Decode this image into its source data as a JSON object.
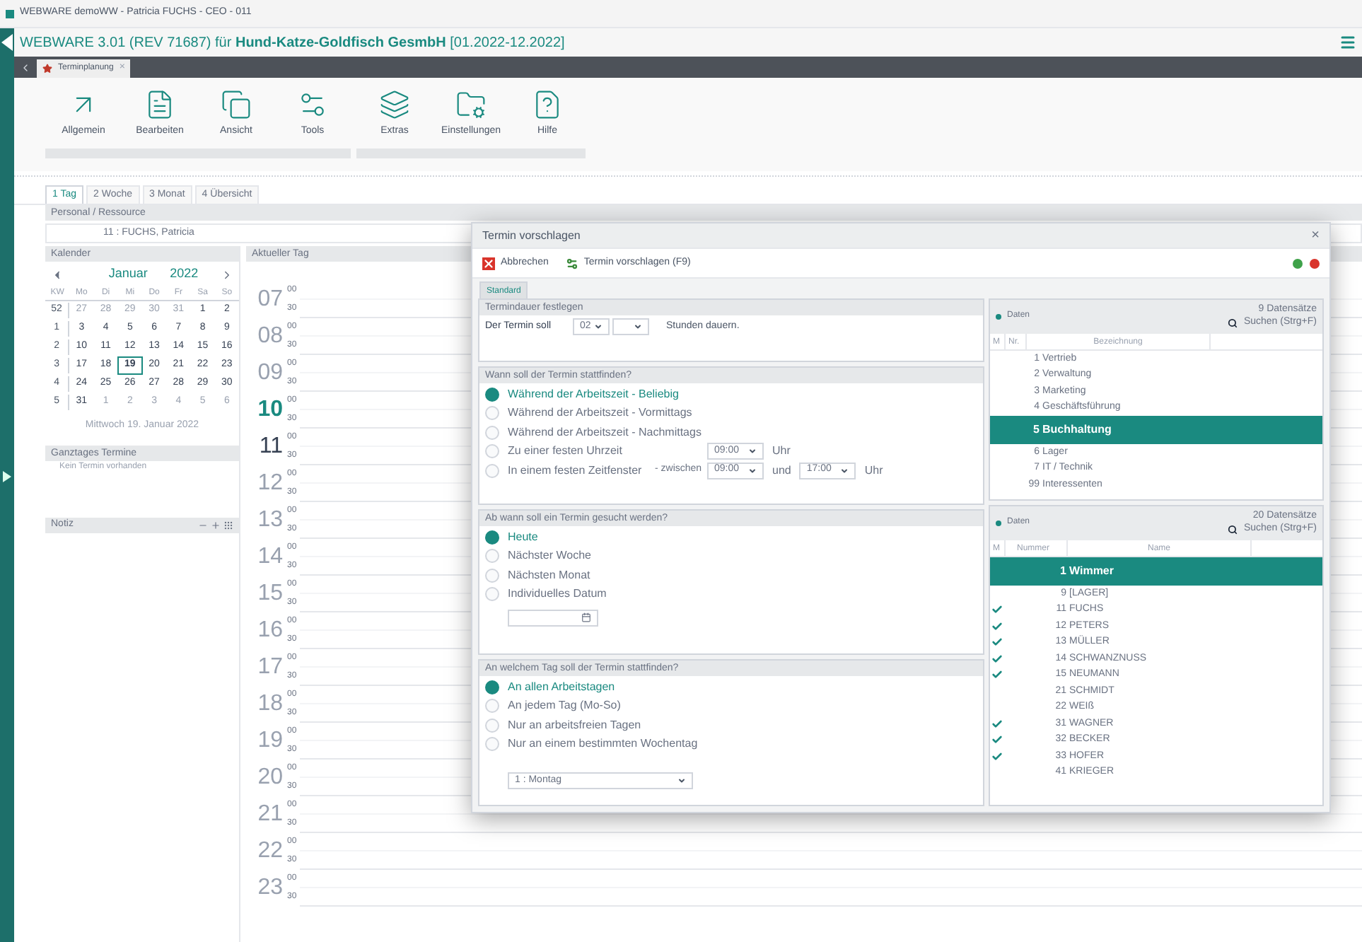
{
  "window": {
    "title": "WEBWARE demoWW - Patricia FUCHS - CEO - 011"
  },
  "app_title": "WEBWARE 3.01 (REV 71687) für **Hund-Katze-Goldfisch GesmbH** [01.2022-12.2022]",
  "doc_tab": {
    "label": "Terminplanung",
    "close": "×"
  },
  "ribbon": [
    {
      "items": [
        "Allgemein",
        "Bearbeiten",
        "Ansicht",
        "Tools"
      ]
    },
    {
      "items": [
        "Extras",
        "Einstellungen",
        "Hilfe"
      ]
    }
  ],
  "view_tabs": [
    {
      "label": "1 Tag",
      "selected": true
    },
    {
      "label": "2 Woche",
      "selected": false
    },
    {
      "label": "3 Monat",
      "selected": false
    },
    {
      "label": "4 Übersicht",
      "selected": false
    }
  ],
  "resource": {
    "header": "Personal / Ressource",
    "value": "11 : FUCHS, Patricia"
  },
  "calendar": {
    "header": "Kalender",
    "month": "Januar",
    "year": "2022",
    "columns": [
      "KW",
      "Mo",
      "Di",
      "Mi",
      "Do",
      "Fr",
      "Sa",
      "So"
    ],
    "weeks": [
      {
        "week": "52",
        "days": [
          {
            "label": "27",
            "muted": true,
            "selected": false
          },
          {
            "label": "28",
            "muted": true,
            "selected": false
          },
          {
            "label": "29",
            "muted": true,
            "selected": false
          },
          {
            "label": "30",
            "muted": true,
            "selected": false
          },
          {
            "label": "31",
            "muted": true,
            "selected": false
          },
          {
            "label": "1",
            "muted": false,
            "selected": false
          },
          {
            "label": "2",
            "muted": false,
            "selected": false
          }
        ]
      },
      {
        "week": "1",
        "days": [
          {
            "label": "3",
            "muted": false,
            "selected": false
          },
          {
            "label": "4",
            "muted": false,
            "selected": false
          },
          {
            "label": "5",
            "muted": false,
            "selected": false
          },
          {
            "label": "6",
            "muted": false,
            "selected": false
          },
          {
            "label": "7",
            "muted": false,
            "selected": false
          },
          {
            "label": "8",
            "muted": false,
            "selected": false
          },
          {
            "label": "9",
            "muted": false,
            "selected": false
          }
        ]
      },
      {
        "week": "2",
        "days": [
          {
            "label": "10",
            "muted": false,
            "selected": false
          },
          {
            "label": "11",
            "muted": false,
            "selected": false
          },
          {
            "label": "12",
            "muted": false,
            "selected": false
          },
          {
            "label": "13",
            "muted": false,
            "selected": false
          },
          {
            "label": "14",
            "muted": false,
            "selected": false
          },
          {
            "label": "15",
            "muted": false,
            "selected": false
          },
          {
            "label": "16",
            "muted": false,
            "selected": false
          }
        ]
      },
      {
        "week": "3",
        "days": [
          {
            "label": "17",
            "muted": false,
            "selected": false
          },
          {
            "label": "18",
            "muted": false,
            "selected": false
          },
          {
            "label": "19",
            "muted": false,
            "selected": true
          },
          {
            "label": "20",
            "muted": false,
            "selected": false
          },
          {
            "label": "21",
            "muted": false,
            "selected": false
          },
          {
            "label": "22",
            "muted": false,
            "selected": false
          },
          {
            "label": "23",
            "muted": false,
            "selected": false
          }
        ]
      },
      {
        "week": "4",
        "days": [
          {
            "label": "24",
            "muted": false,
            "selected": false
          },
          {
            "label": "25",
            "muted": false,
            "selected": false
          },
          {
            "label": "26",
            "muted": false,
            "selected": false
          },
          {
            "label": "27",
            "muted": false,
            "selected": false
          },
          {
            "label": "28",
            "muted": false,
            "selected": false
          },
          {
            "label": "29",
            "muted": false,
            "selected": false
          },
          {
            "label": "30",
            "muted": false,
            "selected": false
          }
        ]
      },
      {
        "week": "5",
        "days": [
          {
            "label": "31",
            "muted": false,
            "selected": false
          },
          {
            "label": "1",
            "muted": true,
            "selected": false
          },
          {
            "label": "2",
            "muted": true,
            "selected": false
          },
          {
            "label": "3",
            "muted": true,
            "selected": false
          },
          {
            "label": "4",
            "muted": true,
            "selected": false
          },
          {
            "label": "5",
            "muted": true,
            "selected": false
          },
          {
            "label": "6",
            "muted": true,
            "selected": false
          }
        ]
      }
    ],
    "date_text": "Mittwoch 19. Januar 2022"
  },
  "all_day": {
    "header": "Ganztages Termine",
    "text": "Kein Termin vorhanden"
  },
  "notes": {
    "header": "Notiz"
  },
  "day_view": {
    "header": "Aktueller Tag",
    "hours": [
      {
        "label": "07",
        "kind": "normal",
        "minutes": [
          "00",
          "30"
        ]
      },
      {
        "label": "08",
        "kind": "normal",
        "minutes": [
          "00",
          "30"
        ]
      },
      {
        "label": "09",
        "kind": "normal",
        "minutes": [
          "00",
          "30"
        ]
      },
      {
        "label": "10",
        "kind": "current",
        "minutes": [
          "00",
          "30"
        ]
      },
      {
        "label": "11",
        "kind": "next",
        "minutes": [
          "00",
          "30"
        ]
      },
      {
        "label": "12",
        "kind": "normal",
        "minutes": [
          "00",
          "30"
        ]
      },
      {
        "label": "13",
        "kind": "normal",
        "minutes": [
          "00",
          "30"
        ]
      },
      {
        "label": "14",
        "kind": "normal",
        "minutes": [
          "00",
          "30"
        ]
      },
      {
        "label": "15",
        "kind": "normal",
        "minutes": [
          "00",
          "30"
        ]
      },
      {
        "label": "16",
        "kind": "normal",
        "minutes": [
          "00",
          "30"
        ]
      },
      {
        "label": "17",
        "kind": "normal",
        "minutes": [
          "00",
          "30"
        ]
      },
      {
        "label": "18",
        "kind": "normal",
        "minutes": [
          "00",
          "30"
        ]
      },
      {
        "label": "19",
        "kind": "normal",
        "minutes": [
          "00",
          "30"
        ]
      },
      {
        "label": "20",
        "kind": "normal",
        "minutes": [
          "00",
          "30"
        ]
      },
      {
        "label": "21",
        "kind": "normal",
        "minutes": [
          "00",
          "30"
        ]
      },
      {
        "label": "22",
        "kind": "normal",
        "minutes": [
          "00",
          "30"
        ]
      },
      {
        "label": "23",
        "kind": "normal",
        "minutes": [
          "00",
          "30"
        ]
      }
    ]
  },
  "dialog": {
    "title": "Termin vorschlagen",
    "close": "×",
    "actions": [
      "Abbrechen",
      "Termin vorschlagen (F9)"
    ],
    "tab": "Standard",
    "duration": {
      "header": "Termindauer festlegen",
      "prefix": "Der Termin soll",
      "hours": "02",
      "suffix": "Stunden dauern."
    },
    "when": {
      "header": "Wann soll der Termin stattfinden?",
      "options": [
        {
          "kind": "plain",
          "label": "Während der Arbeitszeit - Beliebig",
          "selected": true
        },
        {
          "kind": "plain",
          "label": "Während der Arbeitszeit - Vormittags",
          "selected": false
        },
        {
          "kind": "plain",
          "label": "Während der Arbeitszeit - Nachmittags",
          "selected": false
        },
        {
          "kind": "time",
          "label": "Zu einer festen Uhrzeit",
          "selected": false,
          "time": "09:00",
          "unit": "Uhr"
        },
        {
          "kind": "range",
          "label": "In einem festen Zeitfenster",
          "selected": false,
          "between": "- zwischen",
          "from": "09:00",
          "and": "und",
          "to": "17:00",
          "unit": "Uhr"
        }
      ]
    },
    "from": {
      "header": "Ab wann soll ein Termin gesucht werden?",
      "options": [
        {
          "kind": "plain",
          "label": "Heute",
          "selected": true
        },
        {
          "kind": "plain",
          "label": "Nächster Woche",
          "selected": false
        },
        {
          "kind": "plain",
          "label": "Nächsten Monat",
          "selected": false
        },
        {
          "kind": "date",
          "label": "Individuelles Datum",
          "selected": false
        }
      ]
    },
    "day": {
      "header": "An welchem Tag soll der Termin stattfinden?",
      "options": [
        {
          "kind": "plain",
          "label": "An allen Arbeitstagen",
          "selected": true
        },
        {
          "kind": "plain",
          "label": "An jedem Tag (Mo-So)",
          "selected": false
        },
        {
          "kind": "plain",
          "label": "Nur an arbeitsfreien Tagen",
          "selected": false
        },
        {
          "kind": "weekday",
          "label": "Nur an einem bestimmten Wochentag",
          "selected": false,
          "value": "1 : Montag"
        }
      ]
    },
    "departments": {
      "header": "Daten",
      "count": "9 Datensätze",
      "search": "Suchen (Strg+F)",
      "columns": [
        "M",
        "Nr.",
        "Bezeichnung"
      ],
      "rows": [
        {
          "nr": "1",
          "name": "Vertrieb",
          "selected": false
        },
        {
          "nr": "2",
          "name": "Verwaltung",
          "selected": false
        },
        {
          "nr": "3",
          "name": "Marketing",
          "selected": false
        },
        {
          "nr": "4",
          "name": "Geschäftsführung",
          "selected": false
        },
        {
          "nr": "5",
          "name": "Buchhaltung",
          "selected": true
        },
        {
          "nr": "6",
          "name": "Lager",
          "selected": false
        },
        {
          "nr": "7",
          "name": "IT / Technik",
          "selected": false
        },
        {
          "nr": "99",
          "name": "Interessenten",
          "selected": false
        }
      ]
    },
    "people": {
      "header": "Daten",
      "count": "20 Datensätze",
      "search": "Suchen (Strg+F)",
      "columns": [
        "M",
        "Nummer",
        "Name"
      ],
      "rows": [
        {
          "nr": "1",
          "name": "Wimmer",
          "selected": true,
          "checked": false
        },
        {
          "nr": "9",
          "name": "[LAGER]",
          "selected": false,
          "checked": false
        },
        {
          "nr": "11",
          "name": "FUCHS",
          "selected": false,
          "checked": true
        },
        {
          "nr": "12",
          "name": "PETERS",
          "selected": false,
          "checked": true
        },
        {
          "nr": "13",
          "name": "MÜLLER",
          "selected": false,
          "checked": true
        },
        {
          "nr": "14",
          "name": "SCHWANZNUSS",
          "selected": false,
          "checked": true
        },
        {
          "nr": "15",
          "name": "NEUMANN",
          "selected": false,
          "checked": true
        },
        {
          "nr": "21",
          "name": "SCHMIDT",
          "selected": false,
          "checked": false
        },
        {
          "nr": "22",
          "name": "WEIß",
          "selected": false,
          "checked": false
        },
        {
          "nr": "31",
          "name": "WAGNER",
          "selected": false,
          "checked": true
        },
        {
          "nr": "32",
          "name": "BECKER",
          "selected": false,
          "checked": true
        },
        {
          "nr": "33",
          "name": "HOFER",
          "selected": false,
          "checked": true
        },
        {
          "nr": "41",
          "name": "KRIEGER",
          "selected": false,
          "checked": false
        }
      ]
    }
  }
}
